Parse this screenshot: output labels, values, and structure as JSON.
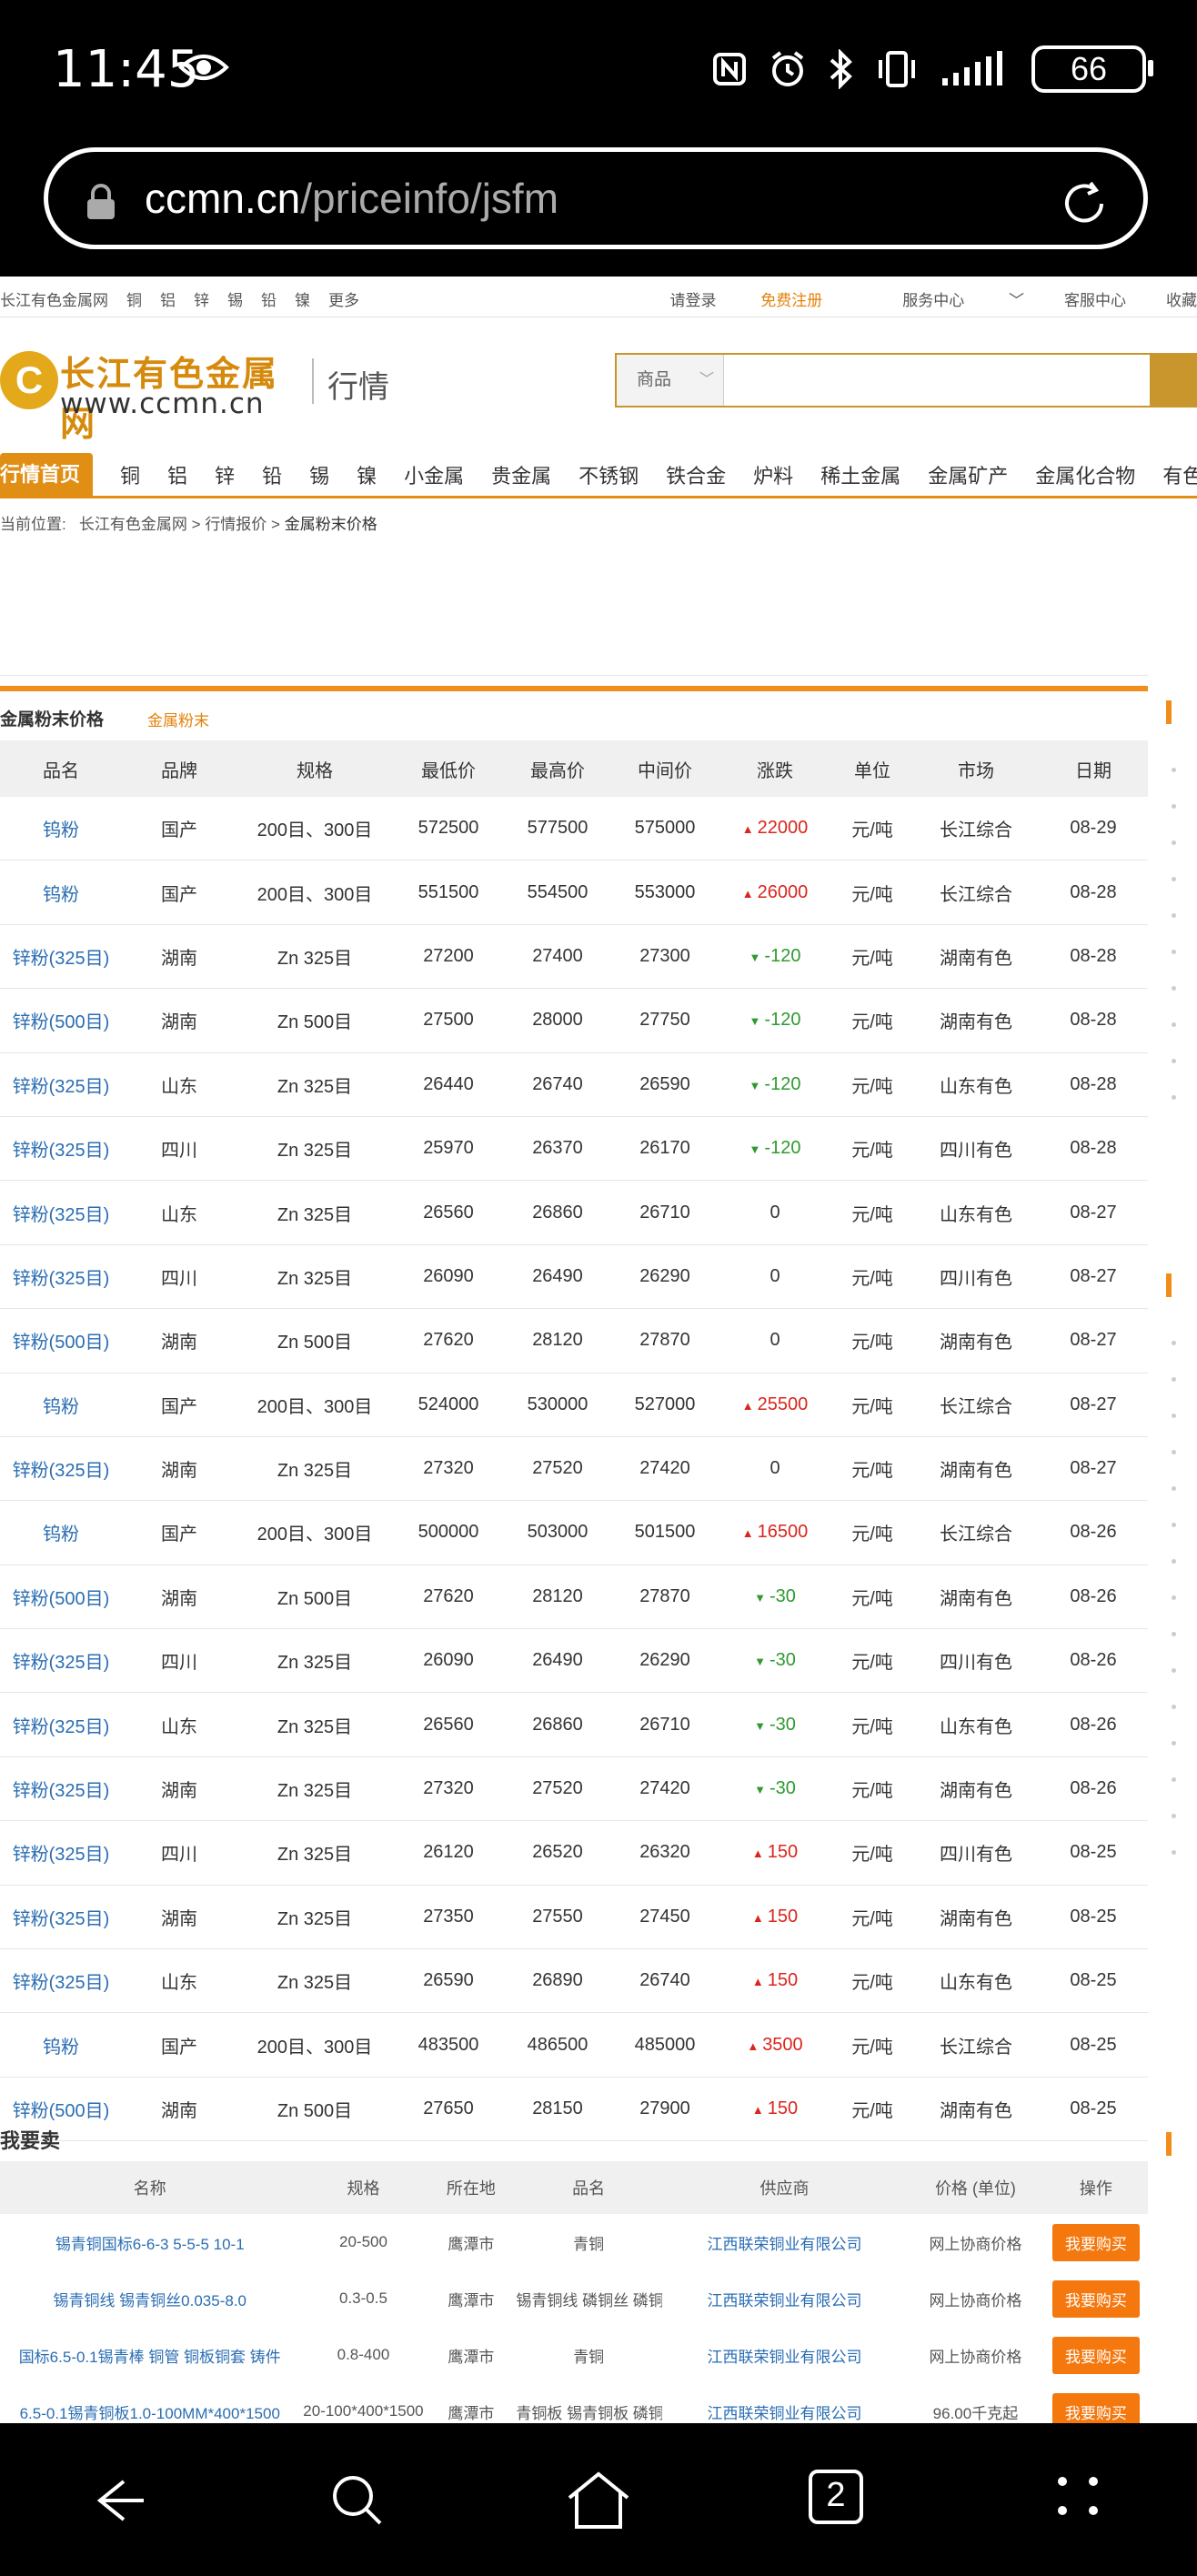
{
  "status": {
    "time": "11:45",
    "battery": "66"
  },
  "browser": {
    "url_domain": "ccmn.cn",
    "url_path": "/priceinfo/jsfm",
    "tab_count": "2"
  },
  "topnav": {
    "left": [
      "长江有色金属网",
      "铜",
      "铝",
      "锌",
      "锡",
      "铅",
      "镍",
      "更多"
    ],
    "login": "请登录",
    "register": "免费注册",
    "service": "服务中心",
    "support": "客服中心",
    "fav": "收藏"
  },
  "logo": {
    "mark": "C",
    "cn": "长江有色金属网",
    "en": "www.ccmn.cn",
    "sub": "行情"
  },
  "search": {
    "category": "商品"
  },
  "mainnav": [
    "行情首页",
    "铜",
    "铝",
    "锌",
    "铅",
    "锡",
    "镍",
    "小金属",
    "贵金属",
    "不锈钢",
    "铁合金",
    "炉料",
    "稀土金属",
    "金属矿产",
    "金属化合物",
    "有色粉末"
  ],
  "breadcrumb": {
    "label": "当前位置:",
    "path1": "长江有色金属网",
    "sep": ">",
    "path2": "行情报价",
    "current": "金属粉末价格"
  },
  "section": {
    "title": "金属粉末价格",
    "tag": "金属粉末"
  },
  "price_table": {
    "headers": [
      "品名",
      "品牌",
      "规格",
      "最低价",
      "最高价",
      "中间价",
      "涨跌",
      "单位",
      "市场",
      "日期"
    ],
    "rows": [
      {
        "name": "钨粉",
        "brand": "国产",
        "spec": "200目、300目",
        "low": "572500",
        "high": "577500",
        "mid": "575000",
        "change": "22000",
        "dir": "up",
        "unit": "元/吨",
        "market": "长江综合",
        "date": "08-29"
      },
      {
        "name": "钨粉",
        "brand": "国产",
        "spec": "200目、300目",
        "low": "551500",
        "high": "554500",
        "mid": "553000",
        "change": "26000",
        "dir": "up",
        "unit": "元/吨",
        "market": "长江综合",
        "date": "08-28"
      },
      {
        "name": "锌粉(325目)",
        "brand": "湖南",
        "spec": "Zn 325目",
        "low": "27200",
        "high": "27400",
        "mid": "27300",
        "change": "-120",
        "dir": "down",
        "unit": "元/吨",
        "market": "湖南有色",
        "date": "08-28"
      },
      {
        "name": "锌粉(500目)",
        "brand": "湖南",
        "spec": "Zn 500目",
        "low": "27500",
        "high": "28000",
        "mid": "27750",
        "change": "-120",
        "dir": "down",
        "unit": "元/吨",
        "market": "湖南有色",
        "date": "08-28"
      },
      {
        "name": "锌粉(325目)",
        "brand": "山东",
        "spec": "Zn 325目",
        "low": "26440",
        "high": "26740",
        "mid": "26590",
        "change": "-120",
        "dir": "down",
        "unit": "元/吨",
        "market": "山东有色",
        "date": "08-28"
      },
      {
        "name": "锌粉(325目)",
        "brand": "四川",
        "spec": "Zn 325目",
        "low": "25970",
        "high": "26370",
        "mid": "26170",
        "change": "-120",
        "dir": "down",
        "unit": "元/吨",
        "market": "四川有色",
        "date": "08-28"
      },
      {
        "name": "锌粉(325目)",
        "brand": "山东",
        "spec": "Zn 325目",
        "low": "26560",
        "high": "26860",
        "mid": "26710",
        "change": "0",
        "dir": "flat",
        "unit": "元/吨",
        "market": "山东有色",
        "date": "08-27"
      },
      {
        "name": "锌粉(325目)",
        "brand": "四川",
        "spec": "Zn 325目",
        "low": "26090",
        "high": "26490",
        "mid": "26290",
        "change": "0",
        "dir": "flat",
        "unit": "元/吨",
        "market": "四川有色",
        "date": "08-27"
      },
      {
        "name": "锌粉(500目)",
        "brand": "湖南",
        "spec": "Zn 500目",
        "low": "27620",
        "high": "28120",
        "mid": "27870",
        "change": "0",
        "dir": "flat",
        "unit": "元/吨",
        "market": "湖南有色",
        "date": "08-27"
      },
      {
        "name": "钨粉",
        "brand": "国产",
        "spec": "200目、300目",
        "low": "524000",
        "high": "530000",
        "mid": "527000",
        "change": "25500",
        "dir": "up",
        "unit": "元/吨",
        "market": "长江综合",
        "date": "08-27"
      },
      {
        "name": "锌粉(325目)",
        "brand": "湖南",
        "spec": "Zn 325目",
        "low": "27320",
        "high": "27520",
        "mid": "27420",
        "change": "0",
        "dir": "flat",
        "unit": "元/吨",
        "market": "湖南有色",
        "date": "08-27"
      },
      {
        "name": "钨粉",
        "brand": "国产",
        "spec": "200目、300目",
        "low": "500000",
        "high": "503000",
        "mid": "501500",
        "change": "16500",
        "dir": "up",
        "unit": "元/吨",
        "market": "长江综合",
        "date": "08-26"
      },
      {
        "name": "锌粉(500目)",
        "brand": "湖南",
        "spec": "Zn 500目",
        "low": "27620",
        "high": "28120",
        "mid": "27870",
        "change": "-30",
        "dir": "down",
        "unit": "元/吨",
        "market": "湖南有色",
        "date": "08-26"
      },
      {
        "name": "锌粉(325目)",
        "brand": "四川",
        "spec": "Zn 325目",
        "low": "26090",
        "high": "26490",
        "mid": "26290",
        "change": "-30",
        "dir": "down",
        "unit": "元/吨",
        "market": "四川有色",
        "date": "08-26"
      },
      {
        "name": "锌粉(325目)",
        "brand": "山东",
        "spec": "Zn 325目",
        "low": "26560",
        "high": "26860",
        "mid": "26710",
        "change": "-30",
        "dir": "down",
        "unit": "元/吨",
        "market": "山东有色",
        "date": "08-26"
      },
      {
        "name": "锌粉(325目)",
        "brand": "湖南",
        "spec": "Zn 325目",
        "low": "27320",
        "high": "27520",
        "mid": "27420",
        "change": "-30",
        "dir": "down",
        "unit": "元/吨",
        "market": "湖南有色",
        "date": "08-26"
      },
      {
        "name": "锌粉(325目)",
        "brand": "四川",
        "spec": "Zn 325目",
        "low": "26120",
        "high": "26520",
        "mid": "26320",
        "change": "150",
        "dir": "up",
        "unit": "元/吨",
        "market": "四川有色",
        "date": "08-25"
      },
      {
        "name": "锌粉(325目)",
        "brand": "湖南",
        "spec": "Zn 325目",
        "low": "27350",
        "high": "27550",
        "mid": "27450",
        "change": "150",
        "dir": "up",
        "unit": "元/吨",
        "market": "湖南有色",
        "date": "08-25"
      },
      {
        "name": "锌粉(325目)",
        "brand": "山东",
        "spec": "Zn 325目",
        "low": "26590",
        "high": "26890",
        "mid": "26740",
        "change": "150",
        "dir": "up",
        "unit": "元/吨",
        "market": "山东有色",
        "date": "08-25"
      },
      {
        "name": "钨粉",
        "brand": "国产",
        "spec": "200目、300目",
        "low": "483500",
        "high": "486500",
        "mid": "485000",
        "change": "3500",
        "dir": "up",
        "unit": "元/吨",
        "market": "长江综合",
        "date": "08-25"
      },
      {
        "name": "锌粉(500目)",
        "brand": "湖南",
        "spec": "Zn 500目",
        "low": "27650",
        "high": "28150",
        "mid": "27900",
        "change": "150",
        "dir": "up",
        "unit": "元/吨",
        "market": "湖南有色",
        "date": "08-25"
      }
    ]
  },
  "sell": {
    "title": "我要卖",
    "headers": [
      "名称",
      "规格",
      "所在地",
      "品名",
      "供应商",
      "价格 (单位)",
      "操作"
    ],
    "rows": [
      {
        "name": "锡青铜国标6-6-3 5-5-5 10-1",
        "spec": "20-500",
        "loc": "鹰潭市",
        "product": "青铜",
        "supplier": "江西联荣铜业有限公司",
        "price": "网上协商价格",
        "action": "我要购买"
      },
      {
        "name": "锡青铜线 锡青铜丝0.035-8.0",
        "spec": "0.3-0.5",
        "loc": "鹰潭市",
        "product": "锡青铜线 磷铜丝 磷铜棒",
        "supplier": "江西联荣铜业有限公司",
        "price": "网上协商价格",
        "action": "我要购买"
      },
      {
        "name": "国标6.5-0.1锡青棒 铜管 铜板铜套 铸件",
        "spec": "0.8-400",
        "loc": "鹰潭市",
        "product": "青铜",
        "supplier": "江西联荣铜业有限公司",
        "price": "网上协商价格",
        "action": "我要购买"
      },
      {
        "name": "6.5-0.1锡青铜板1.0-100MM*400*1500",
        "spec": "20-100*400*1500",
        "loc": "鹰潭市",
        "product": "青铜板 锡青铜板 磷铜板",
        "supplier": "江西联荣铜业有限公司",
        "price": "96.00千克起",
        "action": "我要购买"
      }
    ]
  },
  "colors": {
    "accent": "#e08e14",
    "link": "#2a6db3",
    "up": "#d9261c",
    "down": "#2e9a2e",
    "buy": "#f5780f"
  }
}
